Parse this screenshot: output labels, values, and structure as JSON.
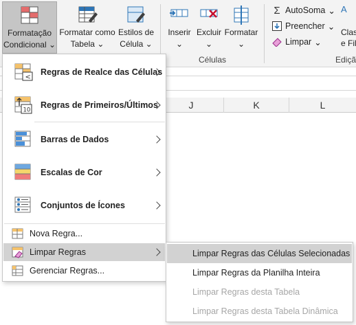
{
  "ribbon": {
    "conditional_formatting": {
      "line1": "Formatação",
      "line2": "Condicional",
      "chevron": "⌄"
    },
    "format_as_table": {
      "line1": "Formatar como",
      "line2": "Tabela",
      "chevron": "⌄"
    },
    "cell_styles": {
      "line1": "Estilos de",
      "line2": "Célula",
      "chevron": "⌄"
    },
    "insert": {
      "label": "Inserir",
      "chevron": "⌄"
    },
    "delete": {
      "label": "Excluir",
      "chevron": "⌄"
    },
    "format": {
      "label": "Formatar",
      "chevron": "⌄"
    },
    "cells_group_label": "Células",
    "autosum": {
      "label": "AutoSoma",
      "chevron": "⌄",
      "icon": "sigma-icon"
    },
    "fill": {
      "label": "Preencher",
      "chevron": "⌄",
      "icon": "fill-down-icon"
    },
    "clear": {
      "label": "Limpar",
      "chevron": "⌄",
      "icon": "eraser-icon"
    },
    "sort_filter": {
      "line1": "Clas",
      "line2": "e Fil"
    },
    "editing_group_label": "Ediçã",
    "sort_icon_letter": "A"
  },
  "grid": {
    "columns": [
      "J",
      "K",
      "L"
    ]
  },
  "menu": {
    "items": [
      {
        "label": "Regras de Realce das Células",
        "icon": "highlight-rules-icon",
        "has_submenu": true
      },
      {
        "label": "Regras de Primeiros/Últimos",
        "icon": "top-bottom-rules-icon",
        "has_submenu": true
      },
      {
        "label": "Barras de Dados",
        "icon": "data-bars-icon",
        "has_submenu": true
      },
      {
        "label": "Escalas de Cor",
        "icon": "color-scales-icon",
        "has_submenu": true
      },
      {
        "label": "Conjuntos de Ícones",
        "icon": "icon-sets-icon",
        "has_submenu": true
      }
    ],
    "small_items": [
      {
        "label": "Nova Regra...",
        "icon": "new-rule-icon",
        "has_submenu": false
      },
      {
        "label": "Limpar Regras",
        "icon": "clear-rules-icon",
        "has_submenu": true
      },
      {
        "label": "Gerenciar Regras...",
        "icon": "manage-rules-icon",
        "has_submenu": false
      }
    ]
  },
  "submenu": {
    "items": [
      {
        "label": "Limpar Regras das Células Selecionadas",
        "enabled": true
      },
      {
        "label": "Limpar Regras da Planilha Inteira",
        "enabled": true
      },
      {
        "label": "Limpar Regras desta Tabela",
        "enabled": false
      },
      {
        "label": "Limpar Regras desta Tabela Dinâmica",
        "enabled": false
      }
    ]
  },
  "colors": {
    "ribbon_bg": "#f3f3f3",
    "highlight": "#d2d2d2",
    "accent_blue": "#2e75b6",
    "accent_red": "#c8102e",
    "disabled_text": "#a6a6a6"
  }
}
